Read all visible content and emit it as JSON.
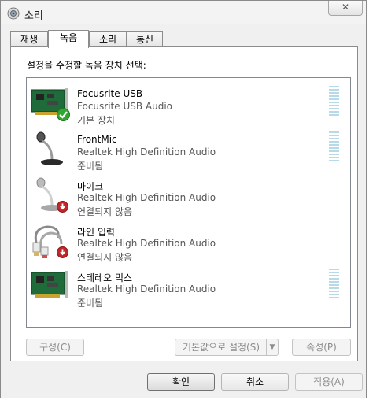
{
  "window": {
    "title": "소리",
    "close_symbol": "✕"
  },
  "tabs": [
    {
      "label": "재생",
      "active": false
    },
    {
      "label": "녹음",
      "active": true
    },
    {
      "label": "소리",
      "active": false
    },
    {
      "label": "통신",
      "active": false
    }
  ],
  "instruction": "설정을 수정할 녹음 장치 선택:",
  "devices": [
    {
      "name": "Focusrite USB",
      "description": "Focusrite USB Audio",
      "status": "기본 장치",
      "icon": "sound-card-icon",
      "badge": "default-check-icon"
    },
    {
      "name": "FrontMic",
      "description": "Realtek High Definition Audio",
      "status": "준비됨",
      "icon": "microphone-icon",
      "badge": ""
    },
    {
      "name": "마이크",
      "description": "Realtek High Definition Audio",
      "status": "연결되지 않음",
      "icon": "microphone-icon",
      "badge": "unplugged-icon"
    },
    {
      "name": "라인 입력",
      "description": "Realtek High Definition Audio",
      "status": "연결되지 않음",
      "icon": "line-in-cable-icon",
      "badge": "unplugged-icon"
    },
    {
      "name": "스테레오 믹스",
      "description": "Realtek High Definition Audio",
      "status": "준비됨",
      "icon": "sound-card-icon",
      "badge": ""
    }
  ],
  "buttons": {
    "configure": "구성(C)",
    "set_default": "기본값으로 설정(S)",
    "properties": "속성(P)",
    "ok": "확인",
    "cancel": "취소",
    "apply": "적용(A)"
  },
  "colors": {
    "check_green": "#2fa82f",
    "unplug_red": "#c0282a",
    "level_meter": "#b8dae8"
  }
}
